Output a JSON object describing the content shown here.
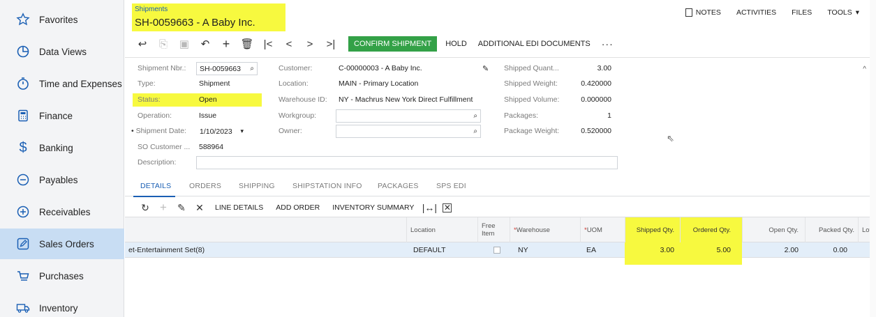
{
  "sidebar": {
    "items": [
      {
        "label": "Favorites",
        "icon": "star-icon"
      },
      {
        "label": "Data Views",
        "icon": "pie-chart-icon"
      },
      {
        "label": "Time and Expenses",
        "icon": "stopwatch-icon"
      },
      {
        "label": "Finance",
        "icon": "calculator-icon"
      },
      {
        "label": "Banking",
        "icon": "dollar-icon"
      },
      {
        "label": "Payables",
        "icon": "minus-circle-icon"
      },
      {
        "label": "Receivables",
        "icon": "plus-circle-icon"
      },
      {
        "label": "Sales Orders",
        "icon": "pencil-square-icon"
      },
      {
        "label": "Purchases",
        "icon": "cart-icon"
      },
      {
        "label": "Inventory",
        "icon": "truck-icon"
      }
    ]
  },
  "header": {
    "subtitle": "Shipments",
    "title": "SH-0059663 - A Baby Inc.",
    "links": {
      "notes": "NOTES",
      "activities": "ACTIVITIES",
      "files": "FILES",
      "tools": "TOOLS"
    }
  },
  "toolbar": {
    "confirm": "CONFIRM SHIPMENT",
    "hold": "HOLD",
    "edi": "ADDITIONAL EDI DOCUMENTS",
    "more": "···"
  },
  "form": {
    "shipment_nbr_label": "Shipment Nbr.:",
    "shipment_nbr": "SH-0059663",
    "type_label": "Type:",
    "type": "Shipment",
    "status_label": "Status:",
    "status": "Open",
    "operation_label": "Operation:",
    "operation": "Issue",
    "shipment_date_label": "Shipment Date:",
    "shipment_date": "1/10/2023",
    "so_customer_label": "SO Customer ...",
    "so_customer": "588964",
    "description_label": "Description:",
    "customer_label": "Customer:",
    "customer": "C-00000003 - A Baby Inc.",
    "location_label": "Location:",
    "location": "MAIN - Primary Location",
    "warehouse_label": "Warehouse ID:",
    "warehouse": "NY - Machrus New York Direct Fulfillment",
    "workgroup_label": "Workgroup:",
    "owner_label": "Owner:",
    "shipped_qty_label": "Shipped Quant...",
    "shipped_qty": "3.00",
    "shipped_weight_label": "Shipped Weight:",
    "shipped_weight": "0.420000",
    "shipped_volume_label": "Shipped Volume:",
    "shipped_volume": "0.000000",
    "packages_label": "Packages:",
    "packages": "1",
    "package_weight_label": "Package Weight:",
    "package_weight": "0.520000"
  },
  "tabs": [
    "DETAILS",
    "ORDERS",
    "SHIPPING",
    "SHIPSTATION INFO",
    "PACKAGES",
    "SPS EDI"
  ],
  "grid_toolbar": {
    "line_details": "LINE DETAILS",
    "add_order": "ADD ORDER",
    "inventory_summary": "INVENTORY SUMMARY"
  },
  "grid": {
    "headers": {
      "location": "Location",
      "free_item": "Free Item",
      "warehouse": "Warehouse",
      "uom": "UOM",
      "shipped_qty": "Shipped Qty.",
      "ordered_qty": "Ordered Qty.",
      "open_qty": "Open Qty.",
      "packed_qty": "Packed Qty.",
      "lot": "Lot/"
    },
    "row": {
      "description": "et-Entertainment Set(8)",
      "location": "DEFAULT",
      "warehouse": "NY",
      "uom": "EA",
      "shipped_qty": "3.00",
      "ordered_qty": "5.00",
      "open_qty": "2.00",
      "packed_qty": "0.00"
    }
  },
  "colors": {
    "highlight": "#f7f93f",
    "primary_button": "#33a147",
    "active_tab": "#1a5fb4",
    "selected_nav": "#c8ddf3",
    "selected_row": "#e3eef9"
  }
}
